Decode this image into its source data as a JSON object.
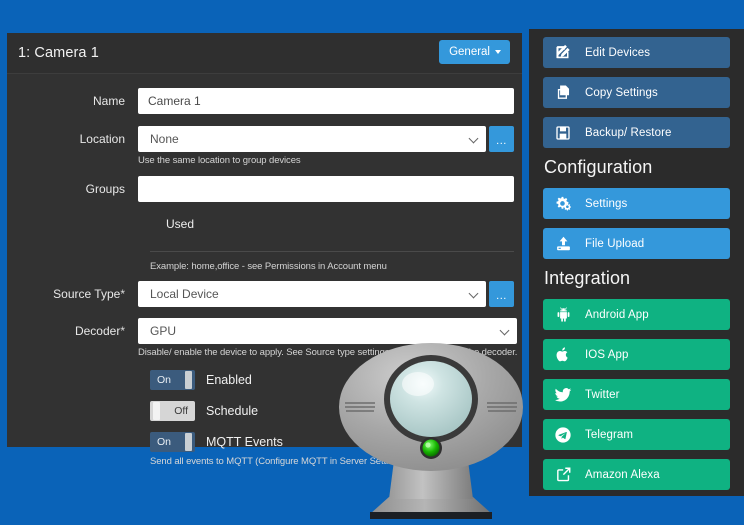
{
  "colors": {
    "page_background": "#0a63b8",
    "card_background": "#323232",
    "sidebar_background": "#2b2b2b",
    "accent_blue": "#3498db",
    "steel_blue": "#336390",
    "green": "#0fb282",
    "toggle_on": "#3b5b7d",
    "toggle_off": "#d6d6d6"
  },
  "card": {
    "title": "1: Camera 1",
    "general_button": "General"
  },
  "form": {
    "name": {
      "label": "Name",
      "value": "Camera 1",
      "placeholder": "Camera 1"
    },
    "location": {
      "label": "Location",
      "value": "None",
      "help": "Use the same location to group devices",
      "dots_label": "..."
    },
    "groups": {
      "label": "Groups",
      "value": "",
      "used_label": "Used",
      "help": "Example: home,office - see Permissions in Account menu"
    },
    "source_type": {
      "label": "Source Type",
      "required_mark": "*",
      "value": "Local Device",
      "dots_label": "..."
    },
    "decoder": {
      "label": "Decoder",
      "required_mark": "*",
      "value": "GPU",
      "help": "Disable/ enable the device to apply. See Source type settings - Advanced to set the decoder."
    }
  },
  "toggles": [
    {
      "state": "On",
      "state_class": "on",
      "label": "Enabled"
    },
    {
      "state": "Off",
      "state_class": "off",
      "label": "Schedule"
    },
    {
      "state": "On",
      "state_class": "on",
      "label": "MQTT Events"
    }
  ],
  "mqtt_help": "Send all events to MQTT (Configure MQTT in Server Settin",
  "sidebar": {
    "top_buttons": [
      {
        "label": "Edit Devices",
        "icon": "edit-pencil-square-icon",
        "style": "steel"
      },
      {
        "label": "Copy Settings",
        "icon": "copy-pages-icon",
        "style": "steel"
      },
      {
        "label": "Backup/ Restore",
        "icon": "floppy-disk-icon",
        "style": "steel"
      }
    ],
    "configuration_title": "Configuration",
    "configuration_buttons": [
      {
        "label": "Settings",
        "icon": "gears-icon",
        "style": "blue"
      },
      {
        "label": "File Upload",
        "icon": "upload-arrow-icon",
        "style": "blue"
      }
    ],
    "integration_title": "Integration",
    "integration_buttons": [
      {
        "label": "Android App",
        "icon": "android-robot-icon",
        "style": "green"
      },
      {
        "label": "IOS App",
        "icon": "apple-logo-icon",
        "style": "green"
      },
      {
        "label": "Twitter",
        "icon": "twitter-bird-icon",
        "style": "green"
      },
      {
        "label": "Telegram",
        "icon": "telegram-paperplane-icon",
        "style": "green"
      },
      {
        "label": "Amazon Alexa",
        "icon": "external-link-icon",
        "style": "green"
      }
    ]
  }
}
